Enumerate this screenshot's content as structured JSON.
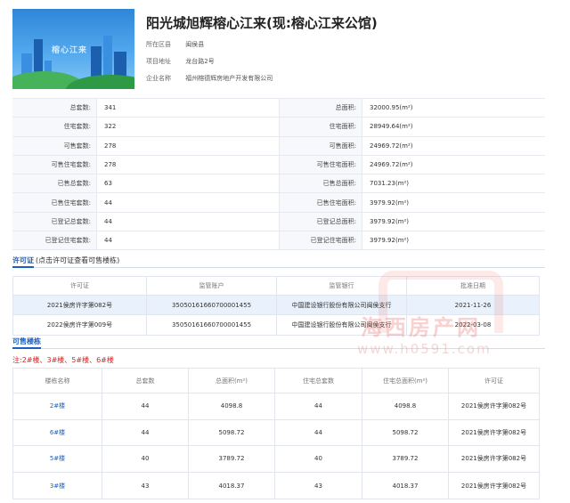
{
  "project": {
    "title": "阳光城旭辉榕心江来(现:榕心江来公馆)",
    "banner_text": "榕心江来",
    "district_label": "所在区县",
    "district": "闽侯县",
    "address_label": "项目地址",
    "address": "龙台路2号",
    "company_label": "企业名称",
    "company": "福州榕德辉房地产开发有限公司"
  },
  "summary": [
    {
      "k1": "总套数:",
      "v1": "341",
      "k2": "总面积:",
      "v2": "32000.95(m²)"
    },
    {
      "k1": "住宅套数:",
      "v1": "322",
      "k2": "住宅面积:",
      "v2": "28949.64(m²)"
    },
    {
      "k1": "可售套数:",
      "v1": "278",
      "k2": "可售面积:",
      "v2": "24969.72(m²)"
    },
    {
      "k1": "可售住宅套数:",
      "v1": "278",
      "k2": "可售住宅面积:",
      "v2": "24969.72(m²)"
    },
    {
      "k1": "已售总套数:",
      "v1": "63",
      "k2": "已售总面积:",
      "v2": "7031.23(m²)"
    },
    {
      "k1": "已售住宅套数:",
      "v1": "44",
      "k2": "已售住宅面积:",
      "v2": "3979.92(m²)"
    },
    {
      "k1": "已登记总套数:",
      "v1": "44",
      "k2": "已登记总面积:",
      "v2": "3979.92(m²)"
    },
    {
      "k1": "已登记住宅套数:",
      "v1": "44",
      "k2": "已登记住宅面积:",
      "v2": "3979.92(m²)"
    }
  ],
  "permit_section": {
    "tab": "许可证",
    "hint": "(点击许可证查看可售楼栋)",
    "headers": [
      "许可证",
      "监管账户",
      "监管银行",
      "批准日期"
    ],
    "rows": [
      [
        "2021侯房许字第082号",
        "35050161660700001455",
        "中国建设银行股份有限公司闽侯支行",
        "2021-11-26"
      ],
      [
        "2022侯房许字第009号",
        "35050161660700001455",
        "中国建设银行股份有限公司闽侯支行",
        "2022-03-08"
      ]
    ]
  },
  "building_section": {
    "tab": "可售楼栋",
    "note": "注:2#楼、3#楼、5#楼、6#楼",
    "headers": [
      "楼栋名称",
      "总套数",
      "总面积(m²)",
      "住宅总套数",
      "住宅总面积(m²)",
      "许可证"
    ],
    "rows": [
      [
        "2#楼",
        "44",
        "4098.8",
        "44",
        "4098.8",
        "2021侯房许字第082号"
      ],
      [
        "6#楼",
        "44",
        "5098.72",
        "44",
        "5098.72",
        "2021侯房许字第082号"
      ],
      [
        "5#楼",
        "40",
        "3789.72",
        "40",
        "3789.72",
        "2021侯房许字第082号"
      ],
      [
        "3#楼",
        "43",
        "4018.37",
        "43",
        "4018.37",
        "2021侯房许字第082号"
      ]
    ]
  },
  "watermark": {
    "cn": "海西房产网",
    "url": "www.h0591.com"
  },
  "colors": {
    "accent": "#1a5fc6",
    "note": "#e02020",
    "label_bg": "#f6f8fb",
    "selected_row": "#e8f1fc"
  }
}
